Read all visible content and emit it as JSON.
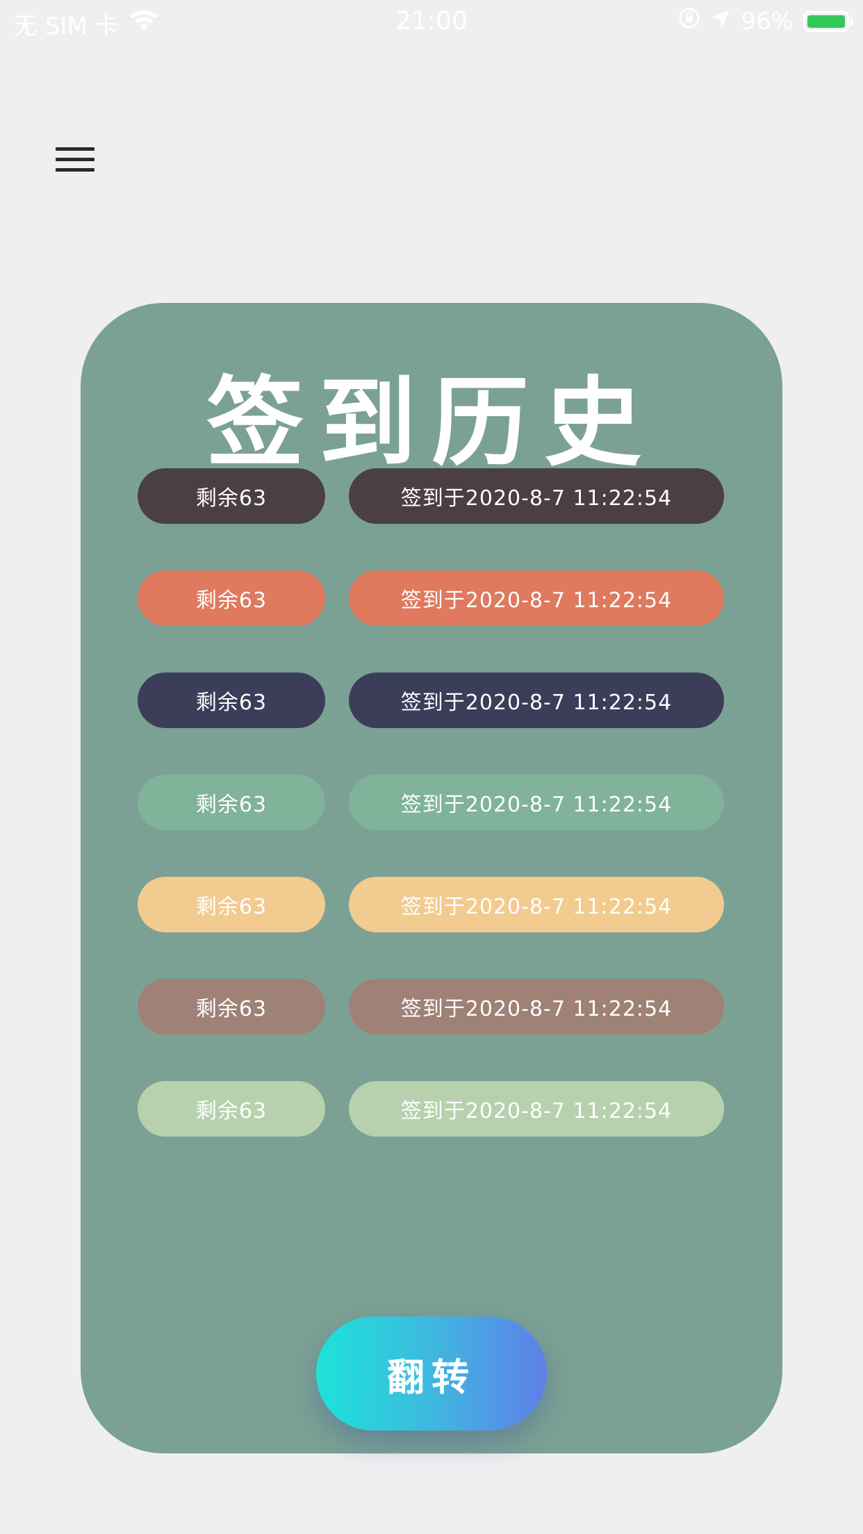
{
  "status_bar": {
    "carrier": "无 SIM 卡",
    "time": "21:00",
    "battery": "96%",
    "icons": [
      "wifi-icon",
      "rotation-lock-icon",
      "location-arrow-icon",
      "battery-charging-icon"
    ]
  },
  "menu": {
    "icon": "hamburger-menu-icon"
  },
  "card": {
    "title": "签到历史",
    "background": "#7ba194",
    "rows": [
      {
        "remaining": "剩余63",
        "date": "签到于2020-8-7 11:22:54",
        "color": "#4a3f41"
      },
      {
        "remaining": "剩余63",
        "date": "签到于2020-8-7 11:22:54",
        "color": "#df7a5e"
      },
      {
        "remaining": "剩余63",
        "date": "签到于2020-8-7 11:22:54",
        "color": "#3c3d59"
      },
      {
        "remaining": "剩余63",
        "date": "签到于2020-8-7 11:22:54",
        "color": "#81b29a"
      },
      {
        "remaining": "剩余63",
        "date": "签到于2020-8-7 11:22:54",
        "color": "#f1cb8f"
      },
      {
        "remaining": "剩余63",
        "date": "签到于2020-8-7 11:22:54",
        "color": "#9f8176"
      },
      {
        "remaining": "剩余63",
        "date": "签到于2020-8-7 11:22:54",
        "color": "#b7d1ae"
      }
    ]
  },
  "flip_button": {
    "label": "翻转"
  }
}
